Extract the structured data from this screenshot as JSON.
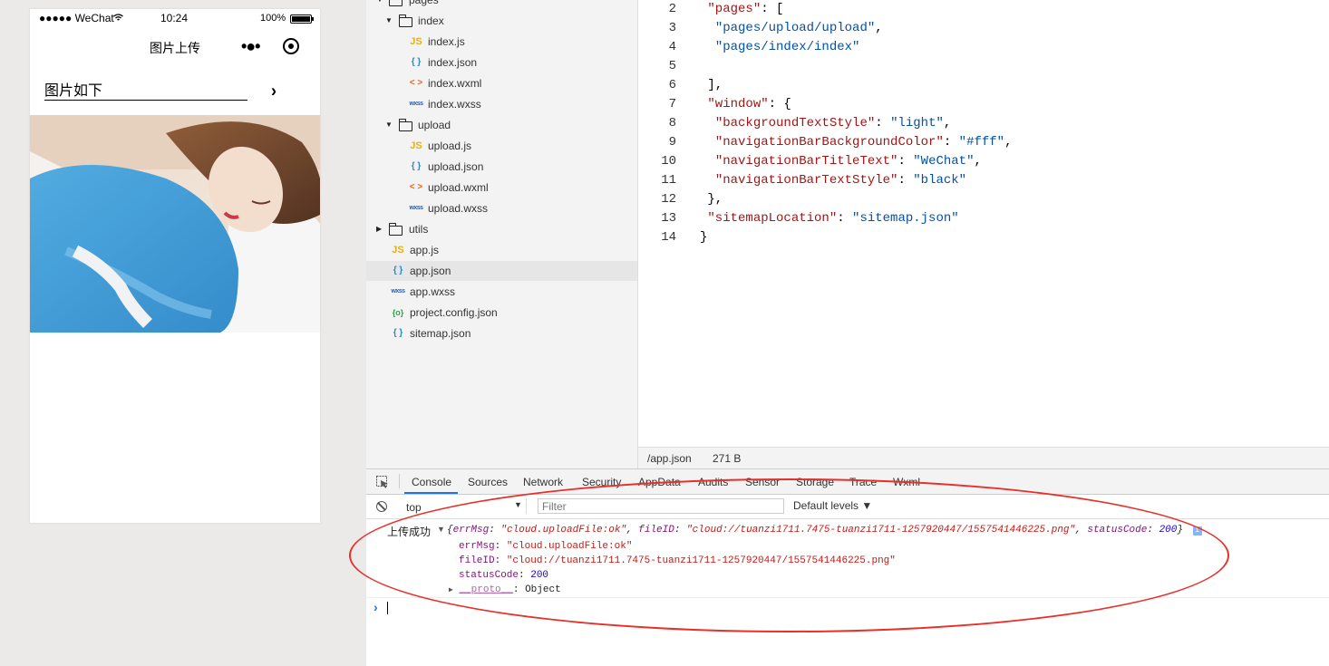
{
  "simulator": {
    "status": {
      "carrier": "●●●●● WeChat",
      "time": "10:24",
      "battery": "100%"
    },
    "nav_title": "图片上传",
    "more_glyph": "•●•",
    "label": "图片如下",
    "arrow_glyph": "›"
  },
  "file_tree": {
    "root": "pages",
    "items": [
      {
        "type": "folder",
        "name": "index",
        "expanded": true
      },
      {
        "type": "js",
        "icon": "JS",
        "name": "index.js"
      },
      {
        "type": "json",
        "icon": "{ }",
        "name": "index.json"
      },
      {
        "type": "wxml",
        "icon": "< >",
        "name": "index.wxml"
      },
      {
        "type": "wxss",
        "icon": "wxss",
        "name": "index.wxss"
      },
      {
        "type": "folder",
        "name": "upload",
        "expanded": true
      },
      {
        "type": "js",
        "icon": "JS",
        "name": "upload.js"
      },
      {
        "type": "json",
        "icon": "{ }",
        "name": "upload.json"
      },
      {
        "type": "wxml",
        "icon": "< >",
        "name": "upload.wxml"
      },
      {
        "type": "wxss",
        "icon": "wxss",
        "name": "upload.wxss"
      },
      {
        "type": "folder",
        "name": "utils",
        "expanded": false
      },
      {
        "type": "js",
        "icon": "JS",
        "name": "app.js"
      },
      {
        "type": "json",
        "icon": "{ }",
        "name": "app.json",
        "selected": true
      },
      {
        "type": "wxss",
        "icon": "wxss",
        "name": "app.wxss"
      },
      {
        "type": "cfg",
        "icon": "{o}",
        "name": "project.config.json"
      },
      {
        "type": "json",
        "icon": "{ }",
        "name": "sitemap.json"
      }
    ]
  },
  "editor": {
    "lines": [
      {
        "n": "2",
        "indent": " ",
        "key": "\"pages\"",
        "rest": ": ["
      },
      {
        "n": "3",
        "indent": "  ",
        "str": "\"pages/upload/upload\"",
        "rest": ","
      },
      {
        "n": "4",
        "indent": "  ",
        "str": "\"pages/index/index\"",
        "rest": ""
      },
      {
        "n": "5",
        "indent": "",
        "rest": ""
      },
      {
        "n": "6",
        "indent": " ",
        "rest": "],"
      },
      {
        "n": "7",
        "indent": " ",
        "key": "\"window\"",
        "rest": ": {"
      },
      {
        "n": "8",
        "indent": "  ",
        "key": "\"backgroundTextStyle\"",
        "sep": ": ",
        "str": "\"light\"",
        "rest": ","
      },
      {
        "n": "9",
        "indent": "  ",
        "key": "\"navigationBarBackgroundColor\"",
        "sep": ": ",
        "str": "\"#fff\"",
        "rest": ","
      },
      {
        "n": "10",
        "indent": "  ",
        "key": "\"navigationBarTitleText\"",
        "sep": ": ",
        "str": "\"WeChat\"",
        "rest": ","
      },
      {
        "n": "11",
        "indent": "  ",
        "key": "\"navigationBarTextStyle\"",
        "sep": ": ",
        "str": "\"black\"",
        "rest": ""
      },
      {
        "n": "12",
        "indent": " ",
        "rest": "},"
      },
      {
        "n": "13",
        "indent": " ",
        "key": "\"sitemapLocation\"",
        "sep": ": ",
        "str": "\"sitemap.json\"",
        "rest": ""
      },
      {
        "n": "14",
        "indent": "",
        "rest": "}"
      }
    ],
    "status_path": "/app.json",
    "status_size": "271 B"
  },
  "devtools": {
    "tabs": [
      "Console",
      "Sources",
      "Network",
      "Security",
      "AppData",
      "Audits",
      "Sensor",
      "Storage",
      "Trace",
      "Wxml"
    ],
    "active_tab": "Console",
    "context": "top",
    "context_arrow": "▼",
    "filter_placeholder": "Filter",
    "levels": "Default levels ▼",
    "log": {
      "prefix": "上传成功",
      "toggle": "▼",
      "summary": {
        "open": "{",
        "errMsg_key": "errMsg",
        "errMsg_val": "\"cloud.uploadFile:ok\"",
        "fileID_key": "fileID",
        "fileID_val": "\"cloud://tuanzi1711.7475-tuanzi1711-1257920447/1557541446225.png\"",
        "status_key": "statusCode",
        "status_val": "200",
        "close": "}",
        "info_badge": "i"
      },
      "props": {
        "errMsg_key": "errMsg",
        "errMsg_val": "\"cloud.uploadFile:ok\"",
        "fileID_key": "fileID",
        "fileID_val": "\"cloud://tuanzi1711.7475-tuanzi1711-1257920447/1557541446225.png\"",
        "status_key": "statusCode",
        "status_val": "200",
        "proto_toggle": "▶",
        "proto_key": "__proto__",
        "proto_val": "Object"
      }
    },
    "prompt": "›"
  },
  "colors": {
    "annotation": "#e8302a",
    "accent": "#1a73e8"
  }
}
